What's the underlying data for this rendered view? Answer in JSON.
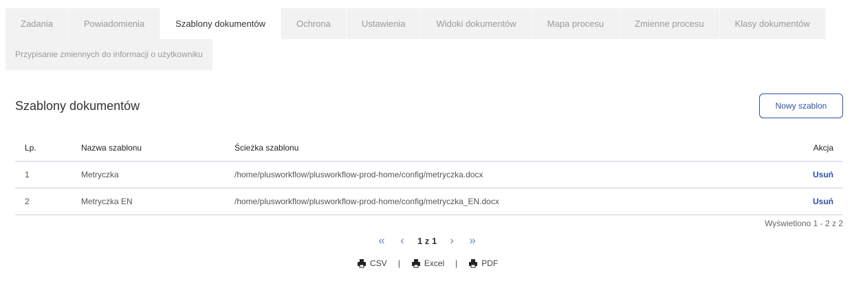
{
  "tabs": [
    {
      "label": "Zadania"
    },
    {
      "label": "Powiadomienia"
    },
    {
      "label": "Szablony dokumentów",
      "active": true
    },
    {
      "label": "Ochrona"
    },
    {
      "label": "Ustawienia"
    },
    {
      "label": "Widoki dokumentów"
    },
    {
      "label": "Mapa procesu"
    },
    {
      "label": "Zmienne procesu"
    },
    {
      "label": "Klasy dokumentów"
    },
    {
      "label": "Przypisanie zmiennych do informacji o użytkowniku"
    }
  ],
  "page": {
    "title": "Szablony dokumentów",
    "new_button": "Nowy szablon"
  },
  "table": {
    "headers": [
      "Lp.",
      "Nazwa szablonu",
      "Ścieżka szablonu",
      "Akcja"
    ],
    "rows": [
      {
        "lp": "1",
        "name": "Metryczka",
        "path": "/home/plusworkflow/plusworkflow-prod-home/config/metryczka.docx",
        "action": "Usuń"
      },
      {
        "lp": "2",
        "name": "Metryczka EN",
        "path": "/home/plusworkflow/plusworkflow-prod-home/config/metryczka_EN.docx",
        "action": "Usuń"
      }
    ]
  },
  "pagination": {
    "shown_text": "Wyświetlono 1 - 2 z 2",
    "page_info": "1 z 1"
  },
  "export": {
    "csv": "CSV",
    "excel": "Excel",
    "pdf": "PDF",
    "separator": "|"
  },
  "colors": {
    "accent": "#2e4fa7",
    "tab_bg": "#f2f2f2"
  }
}
